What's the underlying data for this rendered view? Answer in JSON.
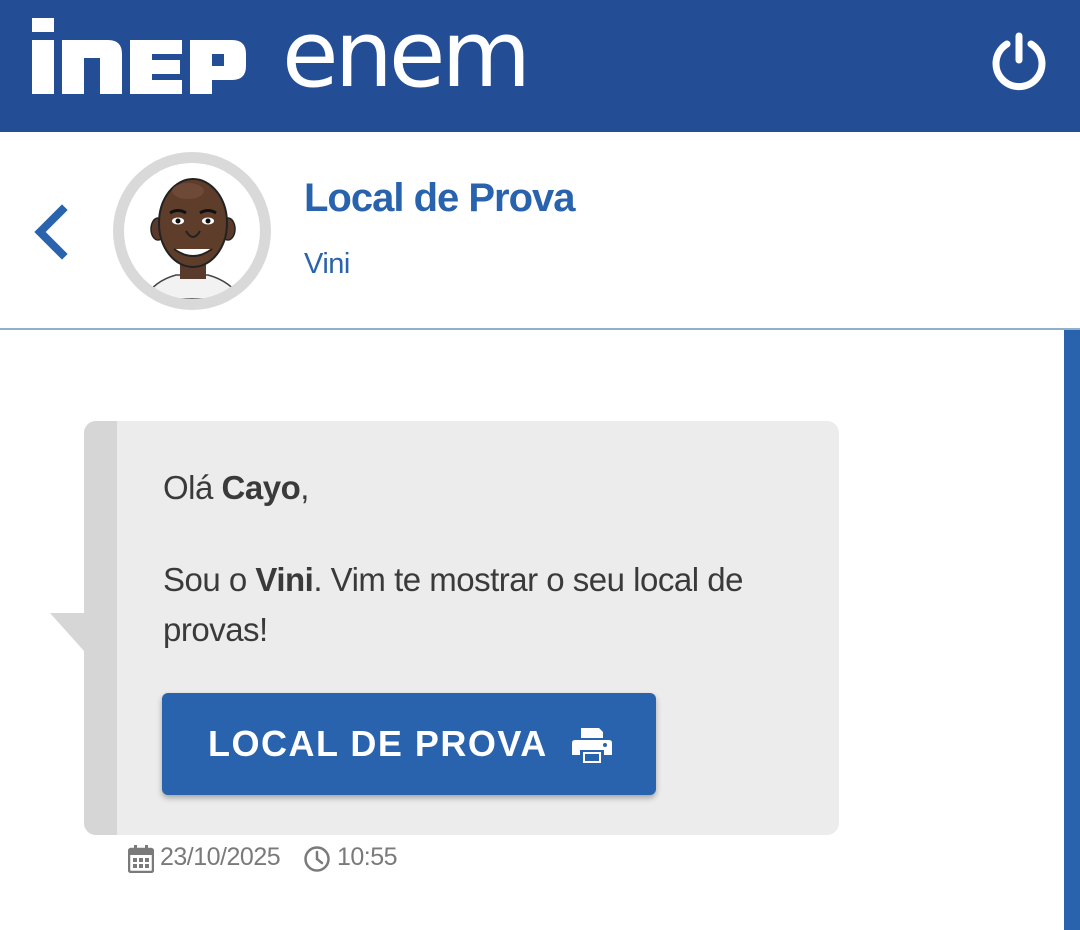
{
  "topbar": {
    "logo_inep": "INEP",
    "logo_enem": "enem",
    "power_icon": "power-icon",
    "background": "#234e96"
  },
  "header": {
    "title": "Local de Prova",
    "subtitle": "Vini",
    "back_icon": "chevron-left-icon",
    "accent": "#2a63ad"
  },
  "message": {
    "greeting_prefix": "Olá ",
    "greeting_name": "Cayo",
    "greeting_suffix": ",",
    "body_prefix": "Sou o ",
    "body_name": "Vini",
    "body_suffix": ". Vim te mostrar o seu local de provas!",
    "button_label": "LOCAL DE PROVA",
    "button_icon": "printer-icon"
  },
  "meta": {
    "date": "23/10/2025",
    "time": "10:55",
    "date_icon": "calendar-icon",
    "time_icon": "clock-icon"
  }
}
